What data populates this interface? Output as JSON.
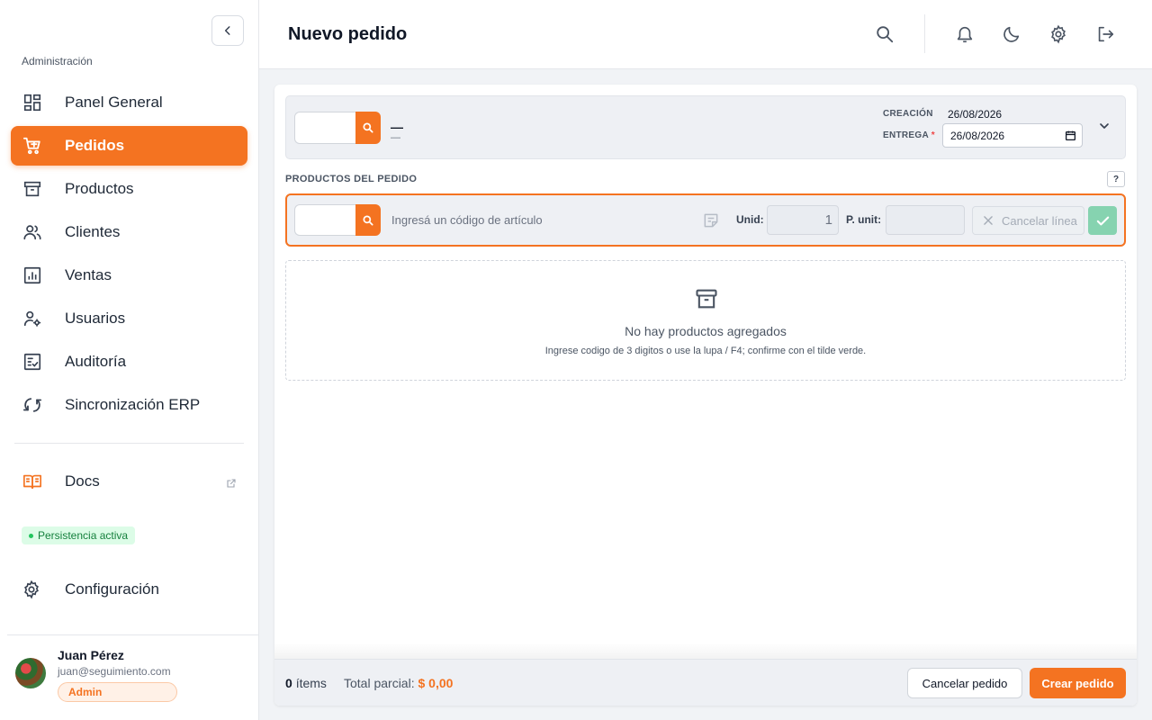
{
  "sidebar": {
    "section_label": "Administración",
    "items": [
      {
        "label": "Panel General",
        "icon": "dashboard-icon"
      },
      {
        "label": "Pedidos",
        "icon": "cart-icon",
        "active": true
      },
      {
        "label": "Productos",
        "icon": "archive-icon"
      },
      {
        "label": "Clientes",
        "icon": "users-icon"
      },
      {
        "label": "Ventas",
        "icon": "chart-icon"
      },
      {
        "label": "Usuarios",
        "icon": "user-gear-icon"
      },
      {
        "label": "Auditoría",
        "icon": "audit-icon"
      },
      {
        "label": "Sincronización ERP",
        "icon": "sync-icon"
      }
    ],
    "docs_label": "Docs",
    "persistence_badge": "Persistencia activa",
    "config_label": "Configuración",
    "user": {
      "name": "Juan Pérez",
      "email": "juan@seguimiento.com",
      "role": "Admin"
    }
  },
  "header": {
    "title": "Nuevo pedido",
    "icons": [
      "search-icon",
      "bell-icon",
      "moon-icon",
      "gear-icon",
      "logout-icon"
    ]
  },
  "order": {
    "client_code": "",
    "client_name": "—",
    "client_sub": "—",
    "creation_label": "CREACIÓN",
    "creation_date": "26/08/2026",
    "delivery_label": "ENTREGA",
    "delivery_required": "*",
    "delivery_date": "26/08/2026"
  },
  "products": {
    "section_label": "PRODUCTOS DEL PEDIDO",
    "help": "?",
    "entry": {
      "code_value": "",
      "placeholder": "Ingresá un código de artículo",
      "unid_label": "Unid:",
      "unid_value": "1",
      "punit_label": "P. unit:",
      "punit_value": "",
      "cancel_line_label": "Cancelar línea"
    },
    "empty_title": "No hay productos agregados",
    "empty_hint": "Ingrese codigo de 3 digitos o use la lupa / F4; confirme con el tilde verde."
  },
  "footer": {
    "items_count": "0",
    "items_label": "ítems",
    "subtotal_label": "Total parcial:",
    "subtotal_value": "$ 0,00",
    "cancel_order_label": "Cancelar pedido",
    "create_order_label": "Crear pedido"
  },
  "colors": {
    "accent": "#f47321",
    "confirm": "#86d3b0",
    "persist_bg": "#dcfce7"
  }
}
